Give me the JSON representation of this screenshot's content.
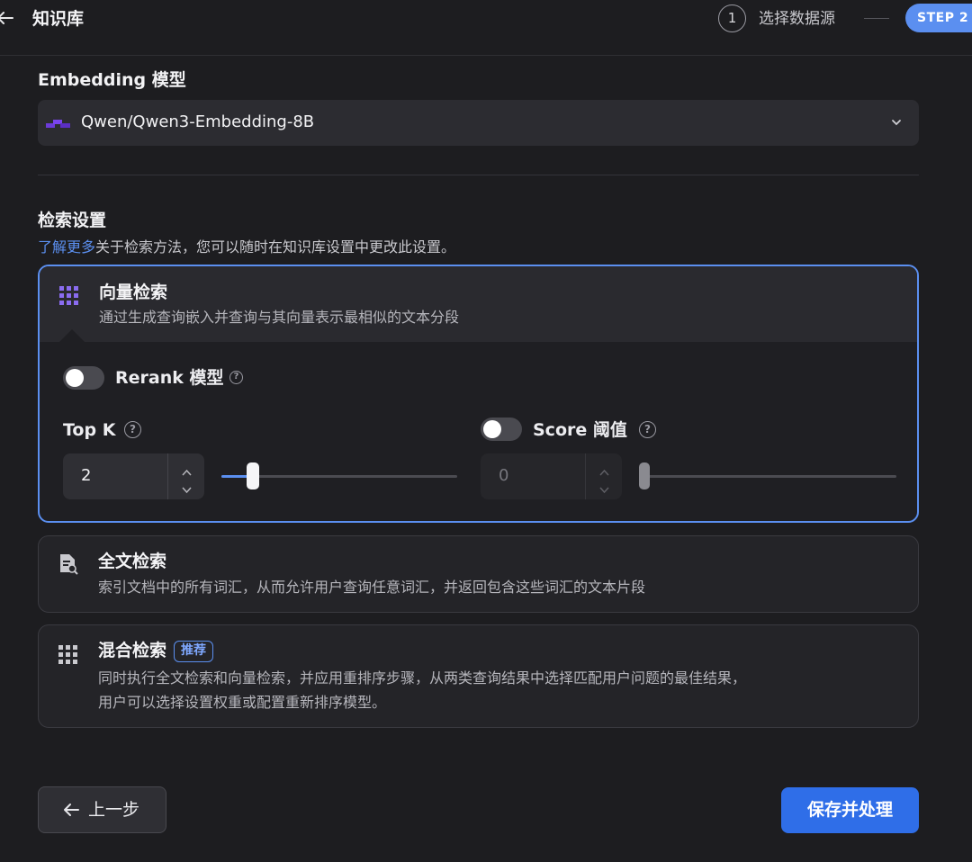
{
  "header": {
    "title": "知识库",
    "step1_number": "1",
    "step1_label": "选择数据源",
    "step2_label": "STEP 2"
  },
  "embedding": {
    "section_title": "Embedding 模型",
    "selected_model": "Qwen/Qwen3-Embedding-8B"
  },
  "retrieval": {
    "section_title": "检索设置",
    "learn_more": "了解更多",
    "hint_rest": "关于检索方法，您可以随时在知识库设置中更改此设置。",
    "vector": {
      "title": "向量检索",
      "desc": "通过生成查询嵌入并查询与其向量表示最相似的文本分段",
      "rerank_label": "Rerank 模型",
      "rerank_enabled": false,
      "topk_label": "Top K",
      "topk_value": "2",
      "score_label": "Score 阈值",
      "score_enabled": false,
      "score_value": "0"
    },
    "fulltext": {
      "title": "全文检索",
      "desc": "索引文档中的所有词汇，从而允许用户查询任意词汇，并返回包含这些词汇的文本片段"
    },
    "hybrid": {
      "title": "混合检索",
      "badge": "推荐",
      "desc_line1": "同时执行全文检索和向量检索，并应用重排序步骤，从两类查询结果中选择匹配用户问题的最佳结果，",
      "desc_line2": "用户可以选择设置权重或配置重新排序模型。"
    }
  },
  "footer": {
    "back_label": "上一步",
    "save_label": "保存并处理"
  },
  "colors": {
    "accent": "#5b8ff0",
    "primary_button": "#2f6ee8",
    "background": "#1d1d20"
  },
  "icons": [
    "arrow-left-icon",
    "chevron-down-icon",
    "grid-dots-icon",
    "document-search-icon",
    "help-circle-icon",
    "model-logo-icon"
  ]
}
